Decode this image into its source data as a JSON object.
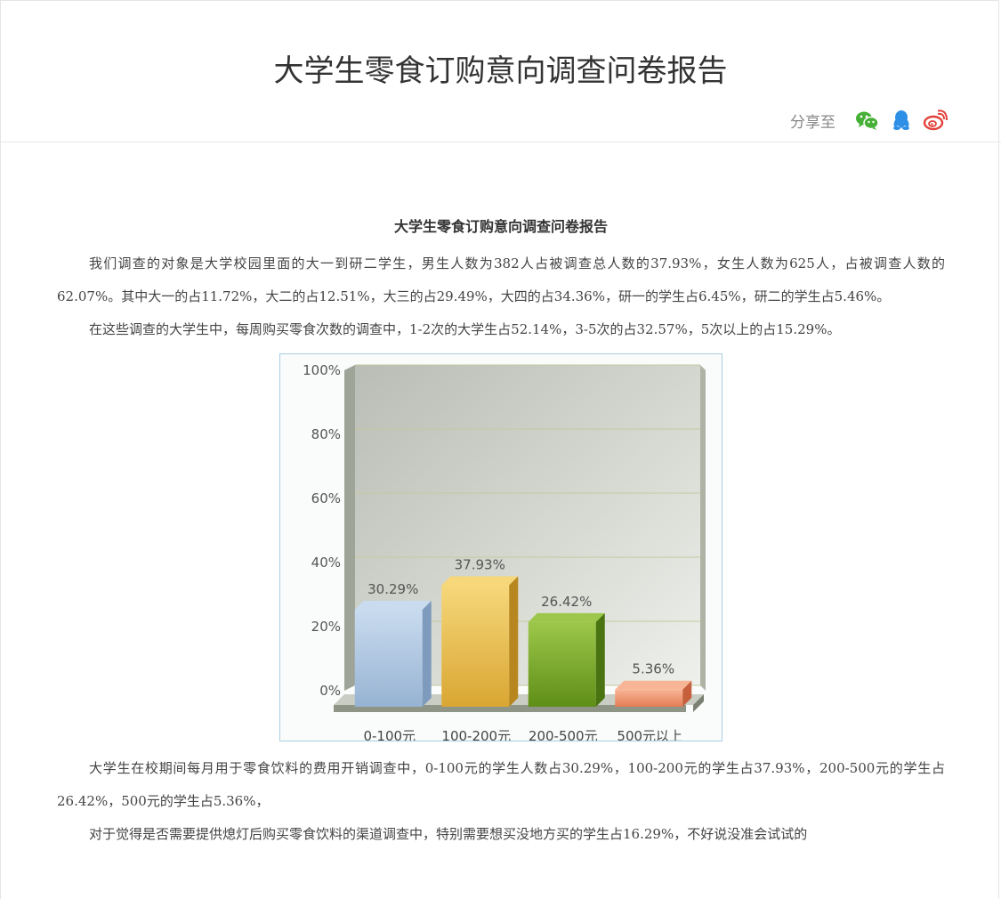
{
  "header": {
    "title": "大学生零食订购意向调查问卷报告",
    "share_label": "分享至",
    "share_icons": [
      "wechat-icon",
      "qq-icon",
      "weibo-icon"
    ],
    "colors": {
      "wechat": "#45b035",
      "qq": "#2e8fe6",
      "weibo": "#e3413b"
    }
  },
  "article": {
    "title": "大学生零食订购意向调查问卷报告",
    "paragraphs": [
      "我们调查的对象是大学校园里面的大一到研二学生，男生人数为382人占被调查总人数的37.93%，女生人数为625人，占被调查人数的62.07%。其中大一的占11.72%，大二的占12.51%，大三的占29.49%，大四的占34.36%，研一的学生占6.45%，研二的学生占5.46%。",
      "在这些调查的大学生中，每周购买零食次数的调查中，1-2次的大学生占52.14%，3-5次的占32.57%，5次以上的占15.29%。",
      "大学生在校期间每月用于零食饮料的费用开销调查中，0-100元的学生人数占30.29%，100-200元的学生占37.93%，200-500元的学生占26.42%，500元的学生占5.36%，",
      "对于觉得是否需要提供熄灯后购买零食饮料的渠道调查中，特别需要想买没地方买的学生占16.29%，不好说没准会试试的"
    ]
  },
  "chart_data": {
    "type": "bar",
    "categories": [
      "0-100元",
      "100-200元",
      "200-500元",
      "500元以上"
    ],
    "values": [
      30.29,
      37.93,
      26.42,
      5.36
    ],
    "value_labels": [
      "30.29%",
      "37.93%",
      "26.42%",
      "5.36%"
    ],
    "yticks": [
      "0%",
      "20%",
      "40%",
      "60%",
      "80%",
      "100%"
    ],
    "ylim": [
      0,
      100
    ],
    "grid": true,
    "colors": [
      "#9db8d6",
      "#e7b93c",
      "#6f9e1e",
      "#e8906a"
    ]
  }
}
